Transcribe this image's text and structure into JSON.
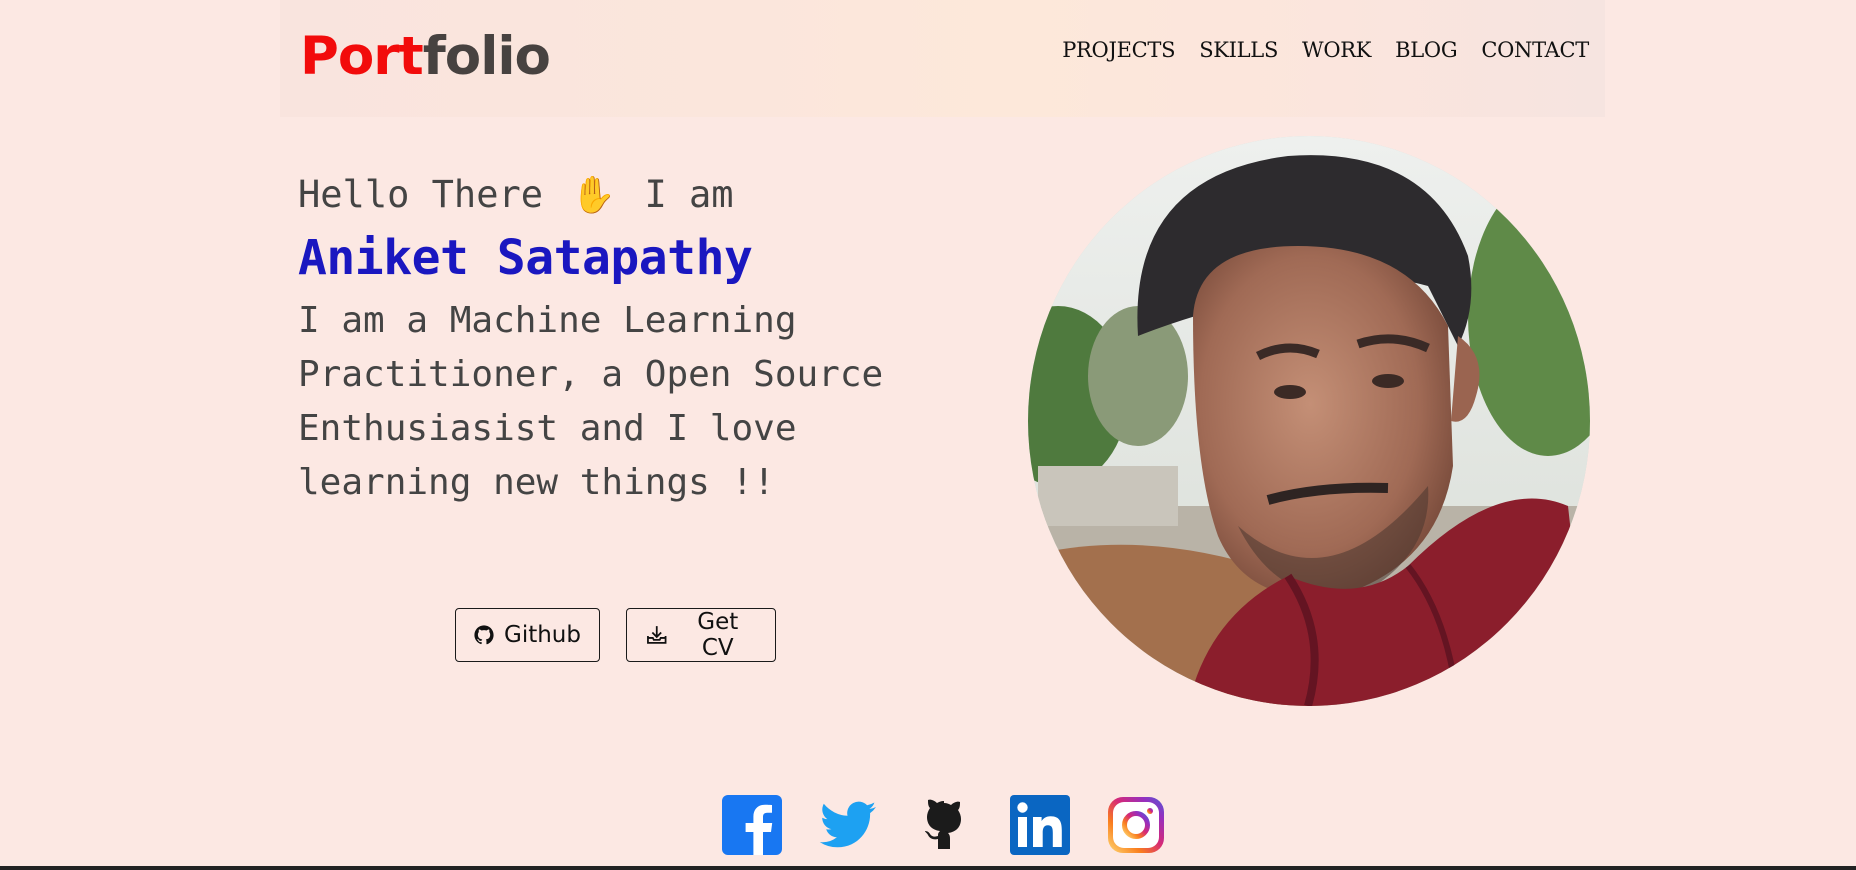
{
  "nav": {
    "logo_part1": "Port",
    "logo_part2": "folio",
    "links": [
      "PROJECTS",
      "SKILLS",
      "WORK",
      "BLOG",
      "CONTACT"
    ]
  },
  "hero": {
    "greeting_before": "Hello There",
    "greeting_after": "I am",
    "wave_icon": "waving-hand",
    "name": "Aniket Satapathy",
    "bio_lines": [
      "I am a Machine Learning",
      "Practitioner, a Open Source",
      "Enthusiasist and I love",
      "learning new things !!"
    ]
  },
  "buttons": {
    "github_label": "Github",
    "cv_label": "Get CV"
  },
  "socials": [
    "facebook-icon",
    "twitter-icon",
    "github-icon",
    "linkedin-icon",
    "instagram-icon"
  ],
  "colors": {
    "background": "#fce8e3",
    "logo_accent": "#f20b0b",
    "name_color": "#1a17c0"
  }
}
